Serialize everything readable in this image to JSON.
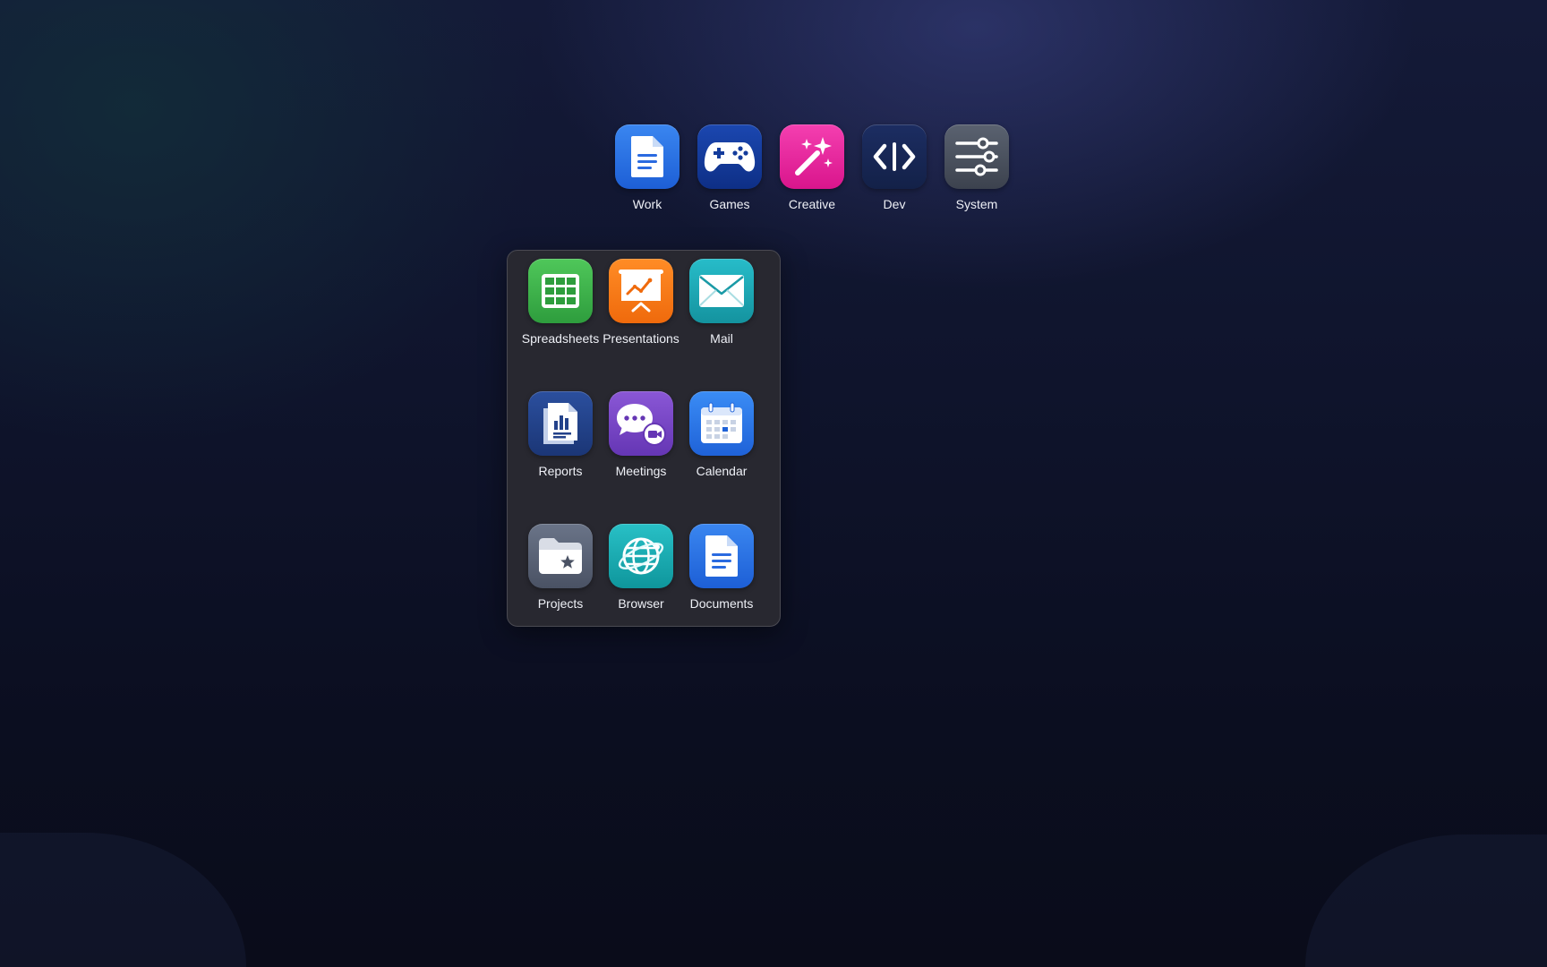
{
  "dock": {
    "items": [
      {
        "label": "Work",
        "icon": "document-icon"
      },
      {
        "label": "Games",
        "icon": "gamepad-icon"
      },
      {
        "label": "Creative",
        "icon": "magic-wand-icon"
      },
      {
        "label": "Dev",
        "icon": "code-icon"
      },
      {
        "label": "System",
        "icon": "sliders-icon"
      }
    ]
  },
  "folder": {
    "apps": [
      {
        "label": "Spreadsheets",
        "icon": "spreadsheet-icon"
      },
      {
        "label": "Presentations",
        "icon": "presentation-icon"
      },
      {
        "label": "Mail",
        "icon": "mail-icon"
      },
      {
        "label": "Reports",
        "icon": "reports-icon"
      },
      {
        "label": "Meetings",
        "icon": "meetings-icon"
      },
      {
        "label": "Calendar",
        "icon": "calendar-icon"
      },
      {
        "label": "Projects",
        "icon": "folder-star-icon"
      },
      {
        "label": "Browser",
        "icon": "globe-icon"
      },
      {
        "label": "Documents",
        "icon": "document-icon"
      }
    ]
  },
  "colors": {
    "work": "#2a74e6",
    "games": "#143c9c",
    "creative": "#eb2aa0",
    "dev": "#182755",
    "system": "#4b525e",
    "spreadsheets": "#3fb54b",
    "presentations": "#f77b19",
    "mail": "#1ea8b4",
    "reports": "#23428a",
    "meetings": "#7746c5",
    "calendar": "#2c77e6",
    "projects": "#5a6376",
    "browser": "#1cabb1",
    "documents": "#2a74e6",
    "folder_panel": "#282830"
  }
}
